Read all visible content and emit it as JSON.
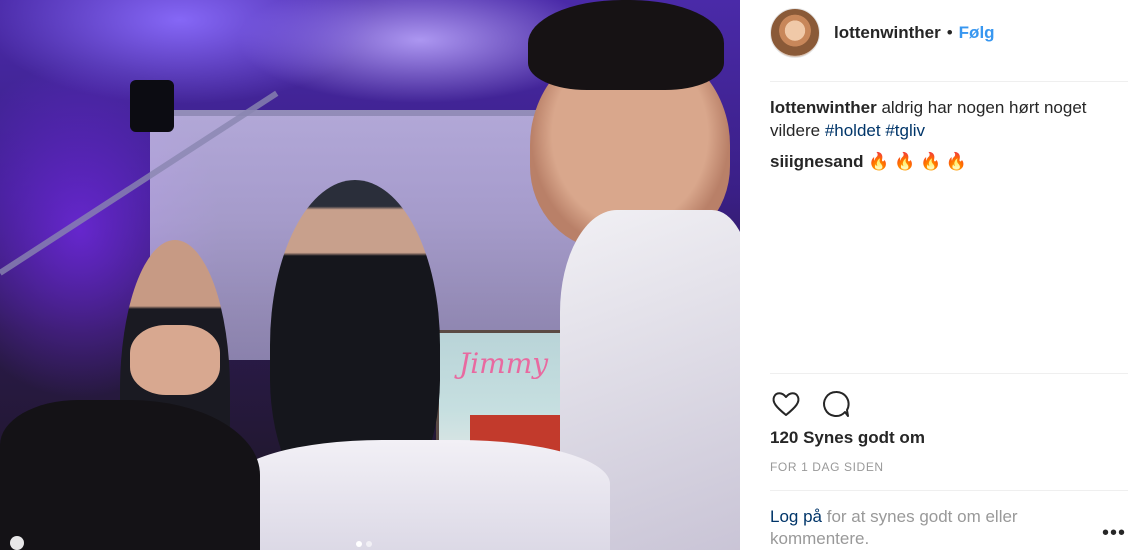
{
  "post": {
    "username": "lottenwinther",
    "separator": "•",
    "follow_label": "Følg",
    "caption": {
      "username": "lottenwinther",
      "text": " aldrig har nogen hørt noget vildere ",
      "hashtags": [
        "#holdet",
        "#tgliv"
      ]
    },
    "comments": [
      {
        "username": "siiignesand",
        "text": " 🔥 🔥 🔥 🔥"
      }
    ],
    "likes": "120 Synes godt om",
    "time": "FOR 1 DAG SIDEN",
    "login": {
      "link": "Log på",
      "text": " for at synes godt om eller kommentere."
    },
    "more_label": "•••"
  },
  "photo": {
    "sign_text": "Jimmy",
    "carousel_count": 2,
    "carousel_active": 0
  },
  "icons": [
    "heart-icon",
    "comment-icon",
    "avatar"
  ],
  "colors": {
    "link": "#3897f0",
    "hashtag": "#003569",
    "muted": "#999999",
    "text": "#262626"
  }
}
